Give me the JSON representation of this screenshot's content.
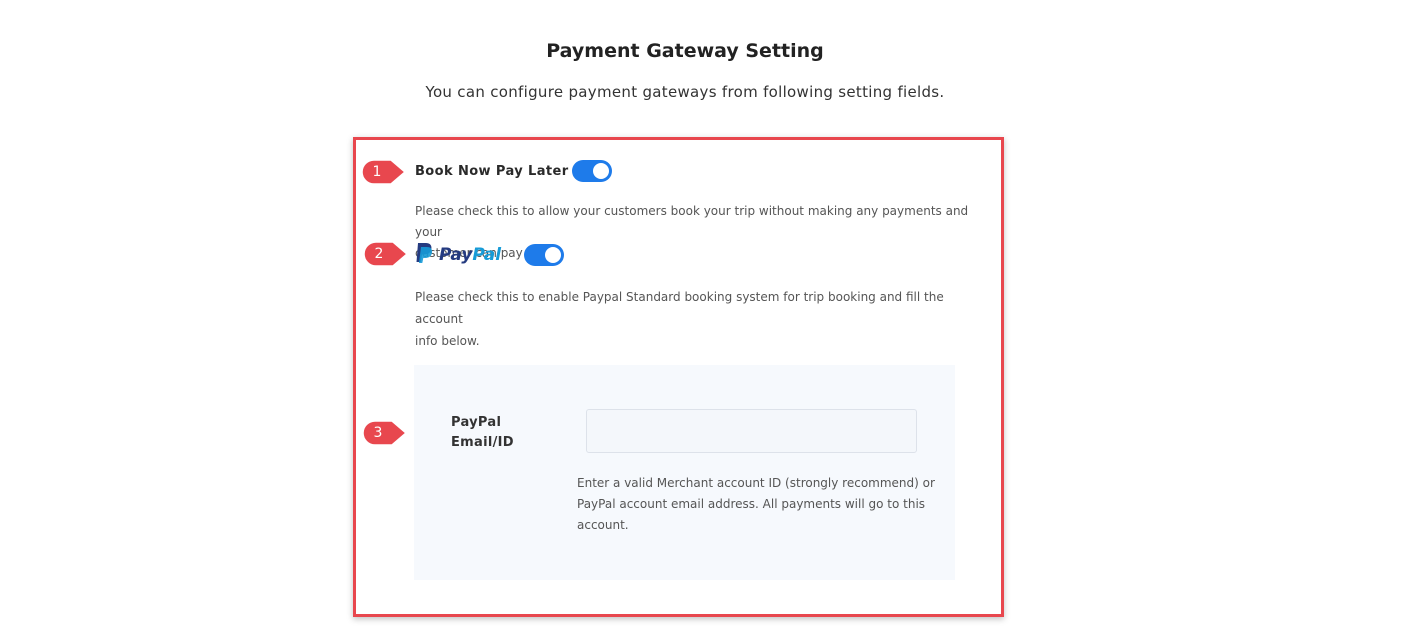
{
  "header": {
    "title": "Payment Gateway Setting",
    "subtitle": "You can configure payment gateways from following setting fields."
  },
  "markers": [
    "1",
    "2",
    "3"
  ],
  "book_now_pay_later": {
    "label": "Book Now Pay Later",
    "enabled": true,
    "help_line1": "Please check this to allow your customers book your trip without making any payments and your",
    "help_line2": "customer can pay later."
  },
  "paypal": {
    "logo_icon": "paypal-p-icon",
    "logo_pay": "Pay",
    "logo_pal": "Pal",
    "enabled": true,
    "help_line1": "Please check this to enable Paypal Standard booking system for trip booking and fill the account",
    "help_line2": "info below.",
    "email_field": {
      "label_line1": "PayPal",
      "label_line2": "Email/ID",
      "value": "",
      "help_line1": "Enter a valid Merchant account ID (strongly recommend) or",
      "help_line2": "PayPal account email address. All payments will go to this",
      "help_line3": "account."
    }
  },
  "colors": {
    "accent": "#1e7bea",
    "annotation": "#e8474e",
    "paypal_dark": "#253b80",
    "paypal_light": "#179bd7"
  }
}
